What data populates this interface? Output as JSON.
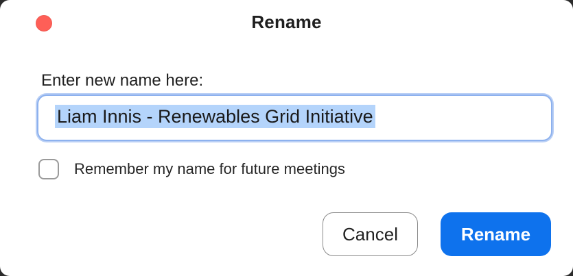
{
  "window": {
    "title": "Rename",
    "close_color": "#fe5f57"
  },
  "form": {
    "prompt": "Enter new name here:",
    "name_value": "Liam Innis - Renewables Grid Initiative",
    "remember_label": "Remember my name for future meetings",
    "remember_checked": false
  },
  "buttons": {
    "cancel_label": "Cancel",
    "rename_label": "Rename"
  },
  "colors": {
    "primary": "#0e72ed",
    "selection": "#b4d4fb",
    "focus_ring": "#8db1ee"
  }
}
